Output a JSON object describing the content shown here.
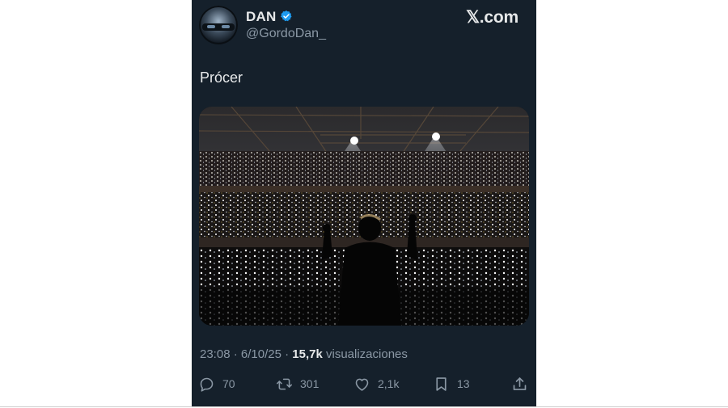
{
  "tweet": {
    "display_name": "DAN",
    "handle": "@GordoDan_",
    "brand": "𝕏.com",
    "text": "Prócer",
    "meta": {
      "time": "23:08",
      "separator1": " · ",
      "date": "6/10/25",
      "separator2": " · ",
      "views": "15,7k",
      "views_label": " visualizaciones"
    },
    "actions": {
      "replies": "70",
      "retweets": "301",
      "likes": "2,1k",
      "bookmarks": "13"
    }
  },
  "colors": {
    "card_background": "#15202b",
    "primary_text": "#e7e9ea",
    "secondary_text": "#8b98a5",
    "verified": "#1d9bf0"
  },
  "icons": [
    "verified-badge-icon",
    "reply-icon",
    "retweet-icon",
    "like-icon",
    "bookmark-icon",
    "share-icon"
  ]
}
